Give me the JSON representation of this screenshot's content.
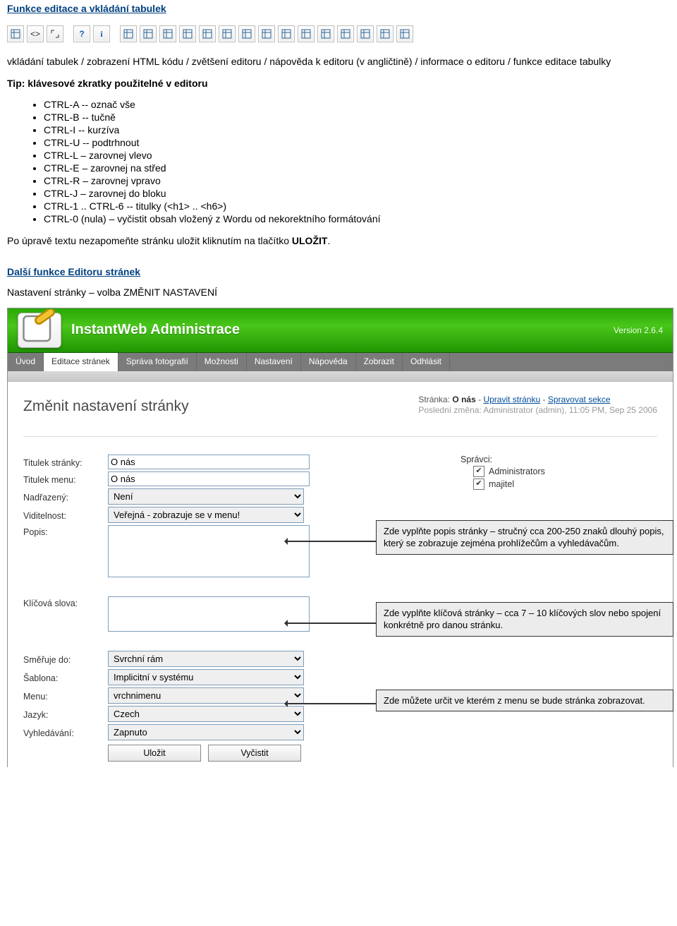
{
  "headings": {
    "h_tables": "Funkce editace a vkládání tabulek",
    "h_more": "Další funkce Editoru stránek"
  },
  "toolbar_icons": [
    "table-icon",
    "code-brackets-icon",
    "expand-icon",
    "help-icon",
    "info-icon",
    "table-edit-icon",
    "table-props-icon",
    "col-insert-before-icon",
    "col-insert-after-icon",
    "col-delete-icon",
    "row-insert-before-icon",
    "row-insert-after-icon",
    "row-delete-icon",
    "table-row-icon",
    "table-rows-icon",
    "cell-props-icon",
    "merge-cells-icon",
    "split-cell-icon",
    "table-grid-icon",
    "table-grid2-icon"
  ],
  "para_desc": "vkládání tabulek / zobrazení HTML kódu / zvětšení editoru / nápověda k editoru (v angličtině) / informace o editoru / funkce editace tabulky",
  "tip_line": "Tip: klávesové zkratky použitelné v editoru",
  "shortcuts": [
    "CTRL-A -- označ vše",
    "CTRL-B -- tučně",
    "CTRL-I -- kurzíva",
    "CTRL-U -- podtrhnout",
    "CTRL-L – zarovnej vlevo",
    "CTRL-E – zarovnej na střed",
    "CTRL-R – zarovnej vpravo",
    "CTRL-J – zarovnej do bloku",
    "CTRL-1 .. CTRL-6 -- titulky (<h1> .. <h6>)",
    "CTRL-0 (nula) – vyčistit obsah vložený z Wordu od nekorektního formátování"
  ],
  "save_line_pre": "Po úpravě textu nezapomeňte stránku uložit kliknutím na tlačítko ",
  "save_line_strong": "ULOŽIT",
  "save_line_post": ".",
  "settings_line": "Nastavení stránky – volba ZMĚNIT NASTAVENÍ",
  "app": {
    "title": "InstantWeb Administrace",
    "version": "Version 2.6.4",
    "menu": [
      "Úvod",
      "Editace stránek",
      "Správa fotografií",
      "Možnosti",
      "Nastavení",
      "Nápověda",
      "Zobrazit",
      "Odhlásit"
    ],
    "content_title": "Změnit nastavení stránky",
    "meta_page_lbl": "Stránka:",
    "meta_page_name": "O nás",
    "meta_dash": " - ",
    "meta_link1": "Upravit stránku",
    "meta_link2": "Spravovat sekce",
    "meta_lastchange": "Poslední změna: Administrator (admin), 11:05 PM, Sep 25 2006",
    "labels": {
      "title": "Titulek stránky:",
      "menu_title": "Titulek menu:",
      "parent": "Nadřazený:",
      "visibility": "Viditelnost:",
      "desc": "Popis:",
      "keywords": "Klíčová slova:",
      "target": "Směřuje do:",
      "template": "Šablona:",
      "menu": "Menu:",
      "lang": "Jazyk:",
      "search": "Vyhledávání:",
      "admins": "Správci:"
    },
    "values": {
      "title": "O nás",
      "menu_title": "O nás",
      "parent": "Není",
      "visibility": "Veřejná - zobrazuje se v menu!",
      "target": "Svrchní rám",
      "template": "Implicitní v systému",
      "menu": "vrchnimenu",
      "lang": "Czech",
      "search": "Zapnuto"
    },
    "admins": [
      "Administrators",
      "majitel"
    ],
    "buttons": {
      "save": "Uložit",
      "clear": "Vyčistit"
    }
  },
  "callouts": {
    "c1": "Zde vyplňte popis stránky – stručný cca 200-250 znaků dlouhý popis, který se zobrazuje zejména prohlížečům a vyhledávačům.",
    "c2": "Zde vyplňte klíčová stránky – cca 7 – 10 klíčových slov nebo spojení konkrétně pro danou stránku.",
    "c3": "Zde můžete určit ve kterém z menu se bude stránka zobrazovat."
  }
}
